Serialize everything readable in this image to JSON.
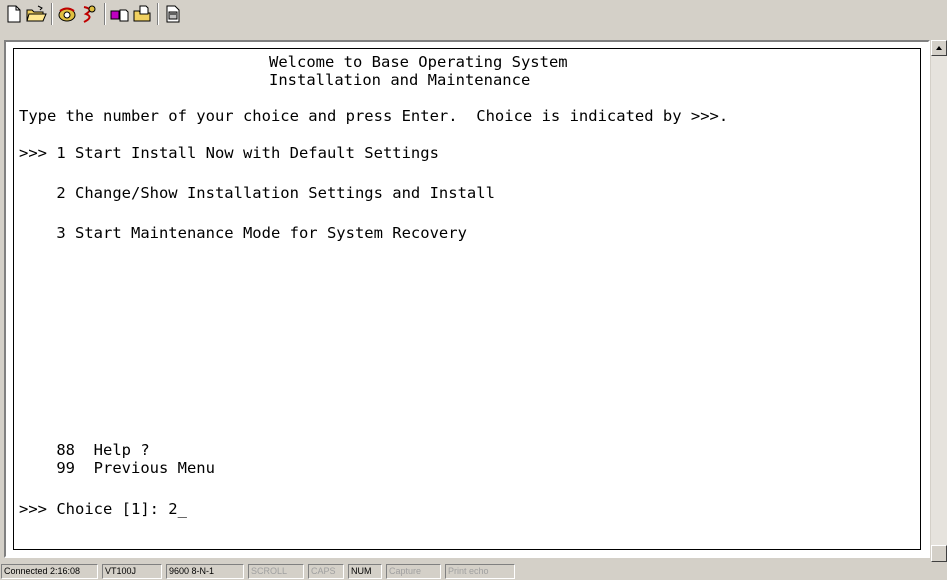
{
  "toolbar": {
    "buttons": [
      {
        "icon": "new-document-icon"
      },
      {
        "icon": "open-folder-icon"
      },
      {
        "icon": "dial-phone-icon"
      },
      {
        "icon": "disconnect-icon"
      },
      {
        "icon": "send-file-icon"
      },
      {
        "icon": "receive-file-icon"
      },
      {
        "icon": "properties-icon"
      }
    ]
  },
  "terminal": {
    "title_line1": "Welcome to Base Operating System",
    "title_line2": "Installation and Maintenance",
    "instruction": "Type the number of your choice and press Enter.  Choice is indicated by >>>.",
    "options": [
      ">>> 1 Start Install Now with Default Settings",
      "    2 Change/Show Installation Settings and Install",
      "    3 Start Maintenance Mode for System Recovery"
    ],
    "help_line": "    88  Help ?",
    "previous_line": "    99  Previous Menu",
    "prompt": ">>> Choice [1]: 2_"
  },
  "statusbar": {
    "connected": "Connected 2:16:08",
    "emulation": "VT100J",
    "settings": "9600 8-N-1",
    "scroll": "SCROLL",
    "caps": "CAPS",
    "num": "NUM",
    "capture": "Capture",
    "print_echo": "Print echo"
  }
}
